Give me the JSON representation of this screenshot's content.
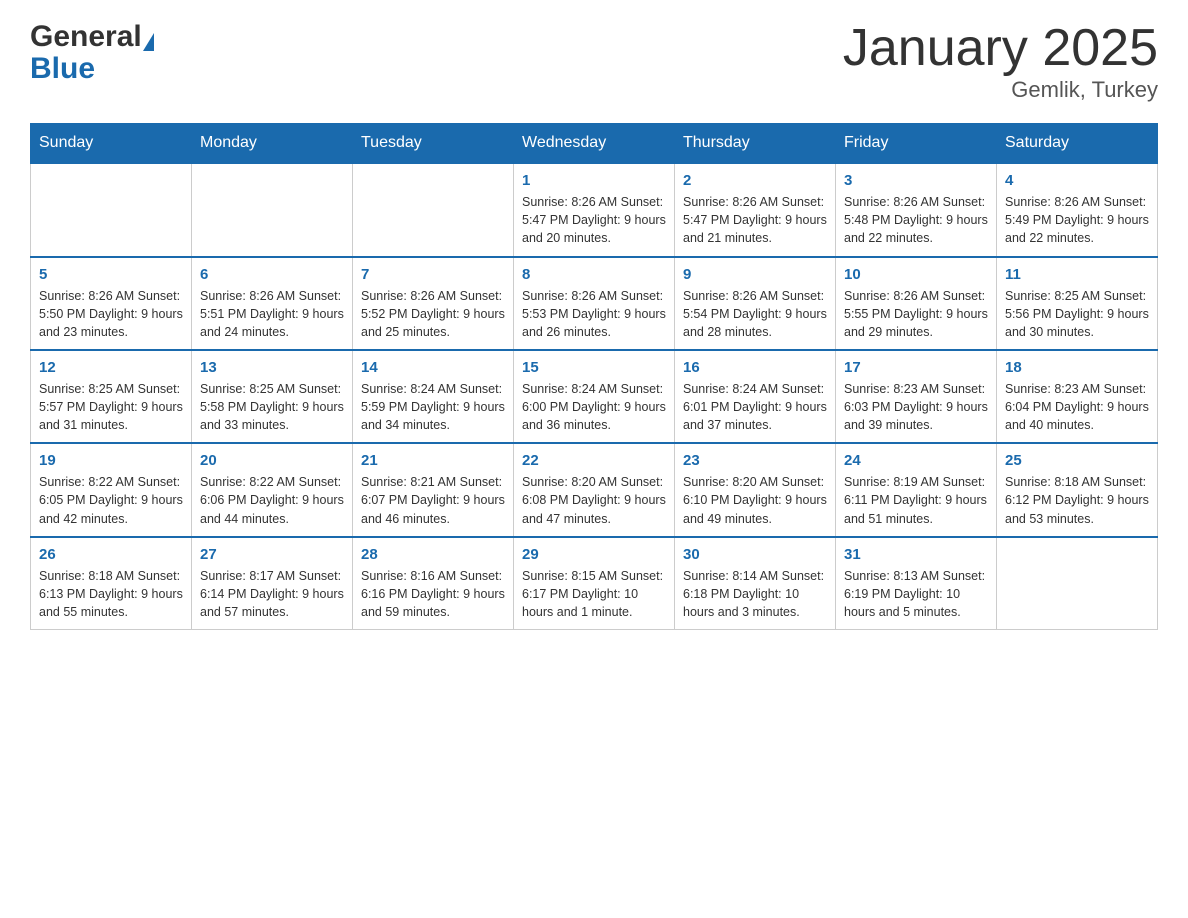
{
  "header": {
    "month_title": "January 2025",
    "location": "Gemlik, Turkey",
    "brand_general": "General",
    "brand_blue": "Blue"
  },
  "days_of_week": [
    "Sunday",
    "Monday",
    "Tuesday",
    "Wednesday",
    "Thursday",
    "Friday",
    "Saturday"
  ],
  "weeks": [
    [
      {
        "day": "",
        "info": ""
      },
      {
        "day": "",
        "info": ""
      },
      {
        "day": "",
        "info": ""
      },
      {
        "day": "1",
        "info": "Sunrise: 8:26 AM\nSunset: 5:47 PM\nDaylight: 9 hours\nand 20 minutes."
      },
      {
        "day": "2",
        "info": "Sunrise: 8:26 AM\nSunset: 5:47 PM\nDaylight: 9 hours\nand 21 minutes."
      },
      {
        "day": "3",
        "info": "Sunrise: 8:26 AM\nSunset: 5:48 PM\nDaylight: 9 hours\nand 22 minutes."
      },
      {
        "day": "4",
        "info": "Sunrise: 8:26 AM\nSunset: 5:49 PM\nDaylight: 9 hours\nand 22 minutes."
      }
    ],
    [
      {
        "day": "5",
        "info": "Sunrise: 8:26 AM\nSunset: 5:50 PM\nDaylight: 9 hours\nand 23 minutes."
      },
      {
        "day": "6",
        "info": "Sunrise: 8:26 AM\nSunset: 5:51 PM\nDaylight: 9 hours\nand 24 minutes."
      },
      {
        "day": "7",
        "info": "Sunrise: 8:26 AM\nSunset: 5:52 PM\nDaylight: 9 hours\nand 25 minutes."
      },
      {
        "day": "8",
        "info": "Sunrise: 8:26 AM\nSunset: 5:53 PM\nDaylight: 9 hours\nand 26 minutes."
      },
      {
        "day": "9",
        "info": "Sunrise: 8:26 AM\nSunset: 5:54 PM\nDaylight: 9 hours\nand 28 minutes."
      },
      {
        "day": "10",
        "info": "Sunrise: 8:26 AM\nSunset: 5:55 PM\nDaylight: 9 hours\nand 29 minutes."
      },
      {
        "day": "11",
        "info": "Sunrise: 8:25 AM\nSunset: 5:56 PM\nDaylight: 9 hours\nand 30 minutes."
      }
    ],
    [
      {
        "day": "12",
        "info": "Sunrise: 8:25 AM\nSunset: 5:57 PM\nDaylight: 9 hours\nand 31 minutes."
      },
      {
        "day": "13",
        "info": "Sunrise: 8:25 AM\nSunset: 5:58 PM\nDaylight: 9 hours\nand 33 minutes."
      },
      {
        "day": "14",
        "info": "Sunrise: 8:24 AM\nSunset: 5:59 PM\nDaylight: 9 hours\nand 34 minutes."
      },
      {
        "day": "15",
        "info": "Sunrise: 8:24 AM\nSunset: 6:00 PM\nDaylight: 9 hours\nand 36 minutes."
      },
      {
        "day": "16",
        "info": "Sunrise: 8:24 AM\nSunset: 6:01 PM\nDaylight: 9 hours\nand 37 minutes."
      },
      {
        "day": "17",
        "info": "Sunrise: 8:23 AM\nSunset: 6:03 PM\nDaylight: 9 hours\nand 39 minutes."
      },
      {
        "day": "18",
        "info": "Sunrise: 8:23 AM\nSunset: 6:04 PM\nDaylight: 9 hours\nand 40 minutes."
      }
    ],
    [
      {
        "day": "19",
        "info": "Sunrise: 8:22 AM\nSunset: 6:05 PM\nDaylight: 9 hours\nand 42 minutes."
      },
      {
        "day": "20",
        "info": "Sunrise: 8:22 AM\nSunset: 6:06 PM\nDaylight: 9 hours\nand 44 minutes."
      },
      {
        "day": "21",
        "info": "Sunrise: 8:21 AM\nSunset: 6:07 PM\nDaylight: 9 hours\nand 46 minutes."
      },
      {
        "day": "22",
        "info": "Sunrise: 8:20 AM\nSunset: 6:08 PM\nDaylight: 9 hours\nand 47 minutes."
      },
      {
        "day": "23",
        "info": "Sunrise: 8:20 AM\nSunset: 6:10 PM\nDaylight: 9 hours\nand 49 minutes."
      },
      {
        "day": "24",
        "info": "Sunrise: 8:19 AM\nSunset: 6:11 PM\nDaylight: 9 hours\nand 51 minutes."
      },
      {
        "day": "25",
        "info": "Sunrise: 8:18 AM\nSunset: 6:12 PM\nDaylight: 9 hours\nand 53 minutes."
      }
    ],
    [
      {
        "day": "26",
        "info": "Sunrise: 8:18 AM\nSunset: 6:13 PM\nDaylight: 9 hours\nand 55 minutes."
      },
      {
        "day": "27",
        "info": "Sunrise: 8:17 AM\nSunset: 6:14 PM\nDaylight: 9 hours\nand 57 minutes."
      },
      {
        "day": "28",
        "info": "Sunrise: 8:16 AM\nSunset: 6:16 PM\nDaylight: 9 hours\nand 59 minutes."
      },
      {
        "day": "29",
        "info": "Sunrise: 8:15 AM\nSunset: 6:17 PM\nDaylight: 10 hours\nand 1 minute."
      },
      {
        "day": "30",
        "info": "Sunrise: 8:14 AM\nSunset: 6:18 PM\nDaylight: 10 hours\nand 3 minutes."
      },
      {
        "day": "31",
        "info": "Sunrise: 8:13 AM\nSunset: 6:19 PM\nDaylight: 10 hours\nand 5 minutes."
      },
      {
        "day": "",
        "info": ""
      }
    ]
  ]
}
